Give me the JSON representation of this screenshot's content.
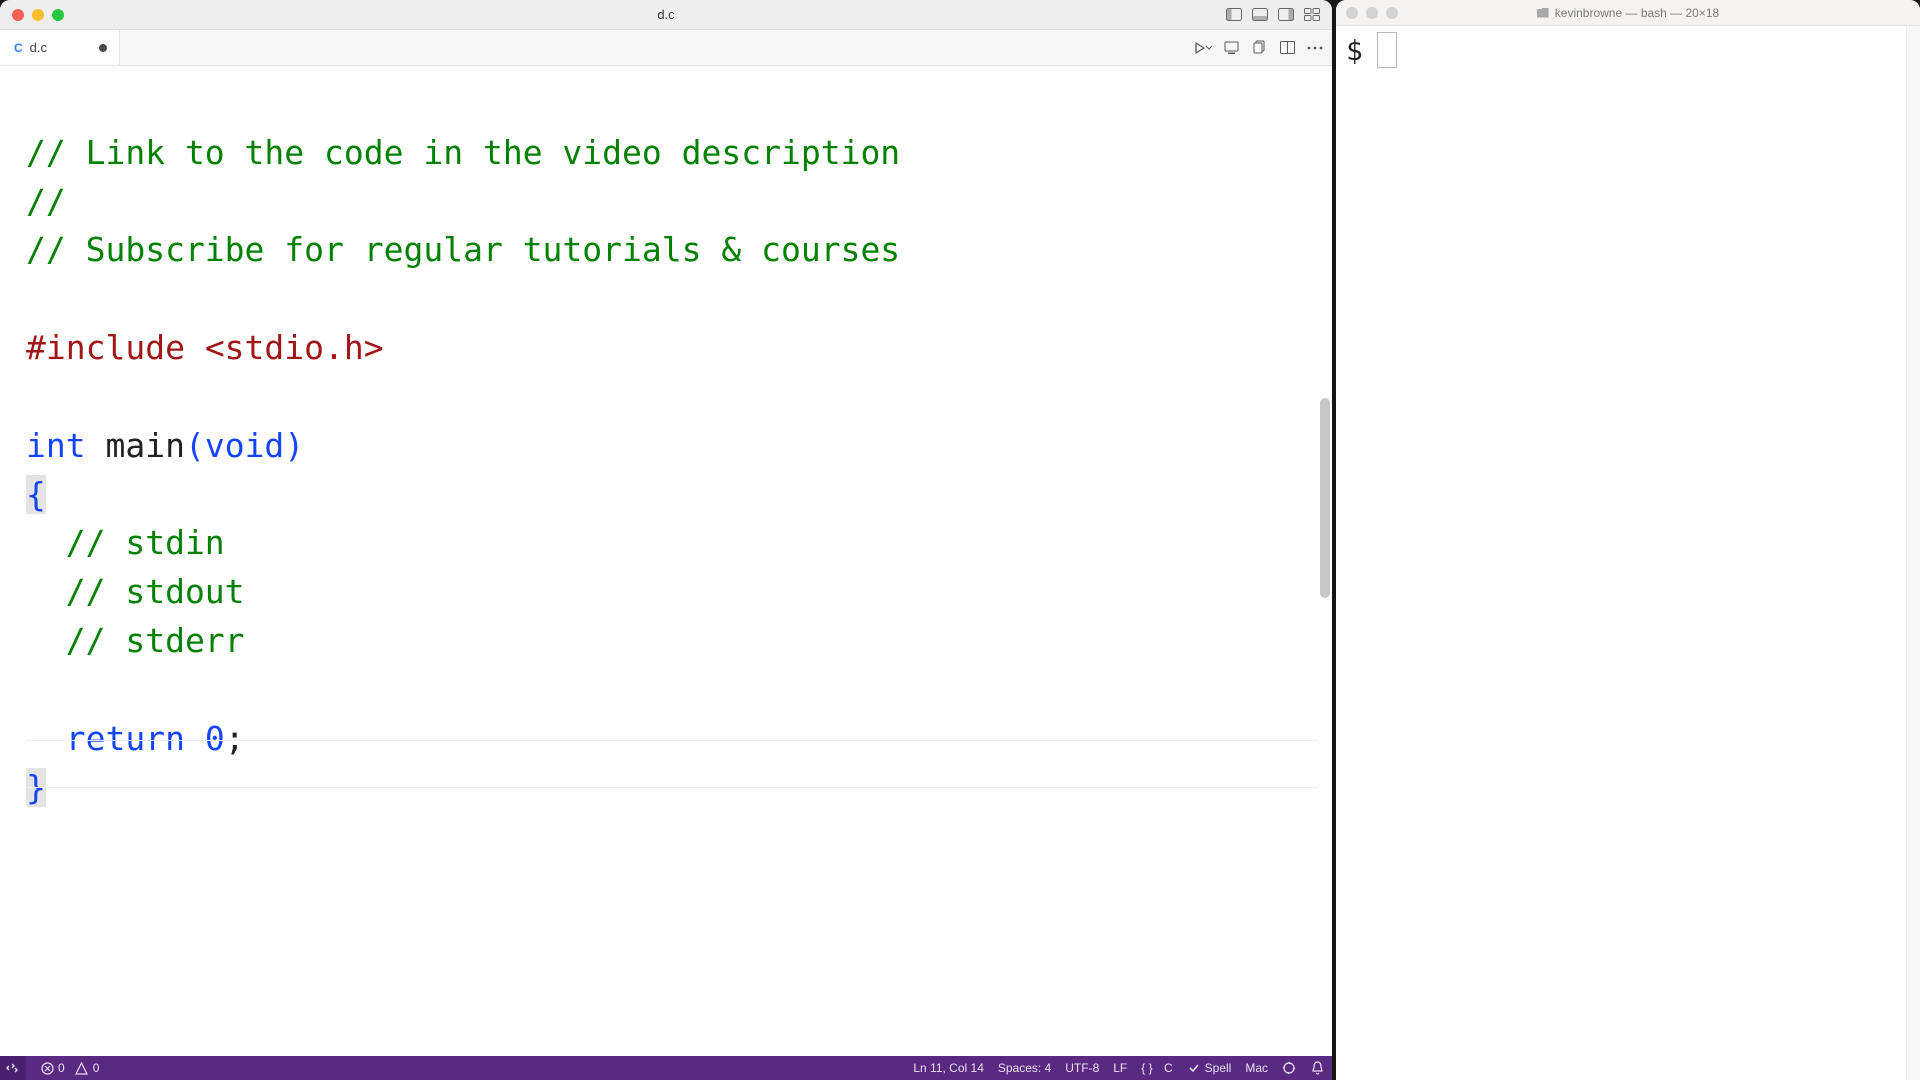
{
  "editor": {
    "window_title": "d.c",
    "tab": {
      "lang_badge": "C",
      "filename": "d.c"
    },
    "code": {
      "l1": "// Link to the code in the video description",
      "l2": "//",
      "l3": "// Subscribe for regular tutorials & courses",
      "l4_pre": "#include ",
      "l4_hdr": "<stdio.h>",
      "l5_type": "int",
      "l5_func": " main",
      "l5_pA": "(",
      "l5_void": "void",
      "l5_pB": ")",
      "l6": "{",
      "l7": "  // stdin",
      "l8": "  // stdout",
      "l9": "  // stderr",
      "l10_kw": "  return ",
      "l10_num": "0",
      "l10_semi": ";",
      "l11": "}"
    },
    "status": {
      "errors": "0",
      "warnings": "0",
      "cursor": "Ln 11, Col 14",
      "spaces": "Spaces: 4",
      "encoding": "UTF-8",
      "eol": "LF",
      "lang_glyph": "{ }",
      "lang": "C",
      "spell": "Spell",
      "os": "Mac"
    }
  },
  "terminal": {
    "title": "kevinbrowne — bash — 20×18",
    "prompt": "$"
  }
}
